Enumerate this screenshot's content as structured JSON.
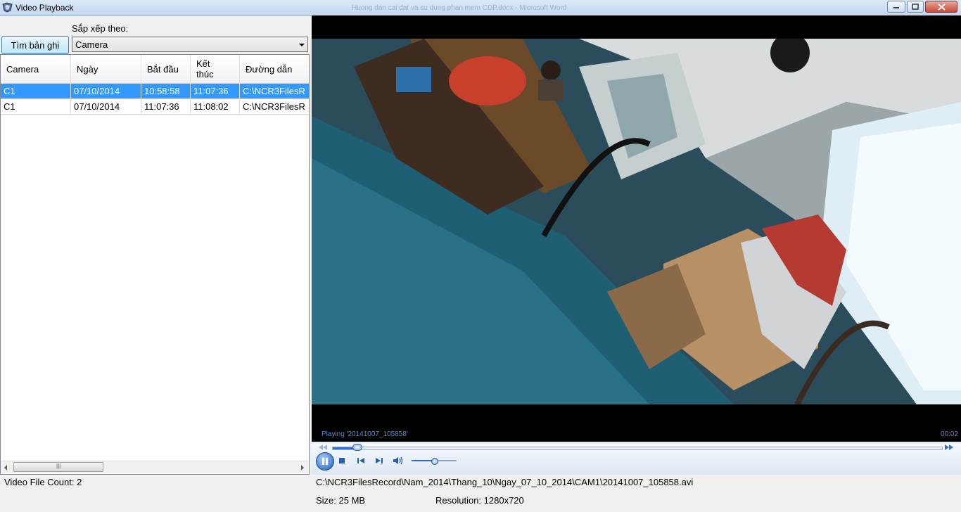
{
  "window": {
    "title": "Video Playback",
    "background_title": "Huong dan cai dat va su dung phan mem CDP.docx - Microsoft Word"
  },
  "toolbar": {
    "find_button": "Tìm bản ghi",
    "sort_label": "Sắp xếp theo:",
    "sort_value": "Camera"
  },
  "table": {
    "columns": [
      {
        "label": "Camera"
      },
      {
        "label": "Ngày"
      },
      {
        "label": "Bắt đầu"
      },
      {
        "label": "Kết thúc"
      },
      {
        "label": "Đường dẫn"
      }
    ],
    "rows": [
      {
        "camera": "C1",
        "date": "07/10/2014",
        "start": "10:58:58",
        "end": "11:07:36",
        "path": "C:\\NCR3FilesR",
        "selected": true
      },
      {
        "camera": "C1",
        "date": "07/10/2014",
        "start": "11:07:36",
        "end": "11:08:02",
        "path": "C:\\NCR3FilesR",
        "selected": false
      }
    ]
  },
  "player": {
    "status_text": "Playing '20141007_105858'",
    "elapsed": "00:02",
    "seek_fraction": 0.04,
    "volume_fraction": 0.5
  },
  "status": {
    "file_count": "Video File Count: 2",
    "file_path": "C:\\NCR3FilesRecord\\Nam_2014\\Thang_10\\Ngay_07_10_2014\\CAM1\\20141007_105858.avi",
    "size": "Size: 25 MB",
    "resolution": "Resolution: 1280x720"
  },
  "colors": {
    "selection": "#3399ff",
    "accent": "#2f70c6",
    "video_bg": "#000000"
  },
  "icons": [
    "app-icon",
    "minimize-icon",
    "maximize-icon",
    "close-icon",
    "dropdown-arrow-icon",
    "pause-icon",
    "stop-icon",
    "previous-icon",
    "next-icon",
    "volume-icon",
    "rewind-icon",
    "fast-forward-icon"
  ]
}
